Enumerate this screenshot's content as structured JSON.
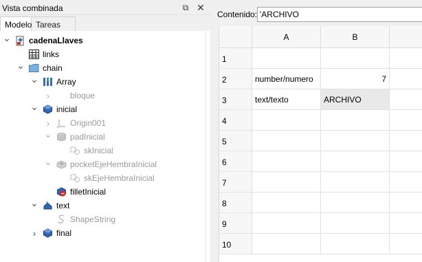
{
  "dock": {
    "title": "Vista combinada",
    "float_glyph": "⧉",
    "close_glyph": "✕",
    "tabs": [
      {
        "label": "Modelo",
        "active": true
      },
      {
        "label": "Tareas",
        "active": false
      }
    ]
  },
  "tree": {
    "nodes": [
      {
        "label": "cadenaLlaves",
        "icon": "document-icon",
        "expand": "down",
        "bold": true,
        "gray": false
      },
      {
        "label": "links",
        "icon": "spreadsheet-icon",
        "expand": "none",
        "bold": false,
        "gray": false
      },
      {
        "label": "chain",
        "icon": "folder-icon",
        "expand": "down",
        "bold": false,
        "gray": false
      },
      {
        "label": "Array",
        "icon": "array-icon",
        "expand": "down",
        "bold": false,
        "gray": false
      },
      {
        "label": "bloque",
        "icon": "none",
        "expand": "right",
        "bold": false,
        "gray": true
      },
      {
        "label": "inicial",
        "icon": "body-icon",
        "expand": "down",
        "bold": false,
        "gray": false
      },
      {
        "label": "Origin001",
        "icon": "origin-icon",
        "expand": "right",
        "bold": false,
        "gray": true
      },
      {
        "label": "padInicial",
        "icon": "pad-icon",
        "expand": "down",
        "bold": false,
        "gray": true
      },
      {
        "label": "skInicial",
        "icon": "sketch-icon",
        "expand": "none",
        "bold": false,
        "gray": true
      },
      {
        "label": "pocketEjeHembraInicial",
        "icon": "pocket-icon",
        "expand": "down",
        "bold": false,
        "gray": true
      },
      {
        "label": "skEjeHembraInicial",
        "icon": "sketch-icon",
        "expand": "none",
        "bold": false,
        "gray": true
      },
      {
        "label": "filletInicial",
        "icon": "fillet-icon",
        "expand": "none",
        "bold": false,
        "gray": false
      },
      {
        "label": "text",
        "icon": "text-body-icon",
        "expand": "down",
        "bold": false,
        "gray": false
      },
      {
        "label": "ShapeString",
        "icon": "shapestring-icon",
        "expand": "none",
        "bold": false,
        "gray": true
      },
      {
        "label": "final",
        "icon": "body-icon",
        "expand": "right",
        "bold": false,
        "gray": false
      }
    ]
  },
  "editor": {
    "label": "Contenido:",
    "value": "'ARCHIVO"
  },
  "sheet": {
    "columns": [
      "A",
      "B"
    ],
    "rows": [
      {
        "num": "1",
        "a": "",
        "b": ""
      },
      {
        "num": "2",
        "a": "number/numero",
        "b": "7"
      },
      {
        "num": "3",
        "a": "text/texto",
        "b": "ARCHIVO"
      },
      {
        "num": "4",
        "a": "",
        "b": ""
      },
      {
        "num": "5",
        "a": "",
        "b": ""
      },
      {
        "num": "6",
        "a": "",
        "b": ""
      },
      {
        "num": "7",
        "a": "",
        "b": ""
      },
      {
        "num": "8",
        "a": "",
        "b": ""
      },
      {
        "num": "9",
        "a": "",
        "b": ""
      },
      {
        "num": "10",
        "a": "",
        "b": ""
      }
    ],
    "selected_cell": "B3"
  }
}
